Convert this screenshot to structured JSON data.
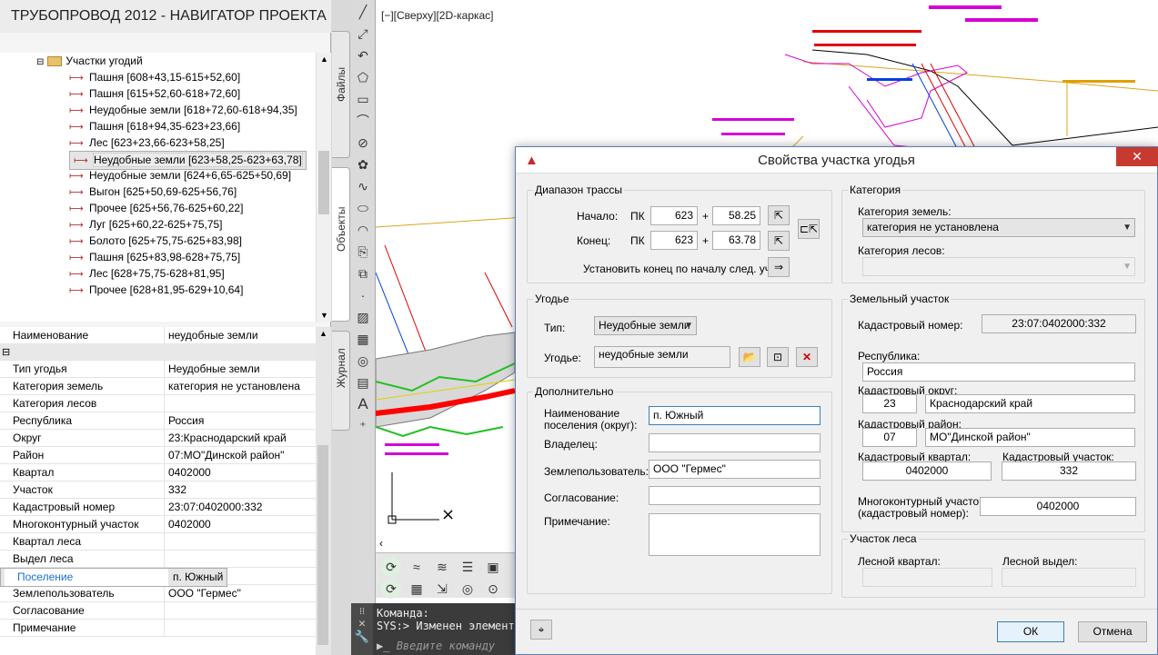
{
  "navigator": {
    "title": "ТРУБОПРОВОД 2012 - НАВИГАТОР ПРОЕКТА",
    "tree_root": "Участки угодий",
    "tree_items": [
      "Пашня [608+43,15-615+52,60]",
      "Пашня [615+52,60-618+72,60]",
      "Неудобные земли [618+72,60-618+94,35]",
      "Пашня [618+94,35-623+23,66]",
      "Лес [623+23,66-623+58,25]",
      "Неудобные земли [623+58,25-623+63,78]",
      "Лес [623+63,78-624+6,65]",
      "Неудобные земли [624+6,65-625+50,69]",
      "Выгон [625+50,69-625+56,76]",
      "Прочее [625+56,76-625+60,22]",
      "Луг [625+60,22-625+75,75]",
      "Болото [625+75,75-625+83,98]",
      "Пашня [625+83,98-628+75,75]",
      "Лес [628+75,75-628+81,95]",
      "Прочее [628+81,95-629+10,64]"
    ],
    "selected_index": 5,
    "properties": [
      {
        "k": "Наименование",
        "v": "неудобные земли"
      },
      {
        "k": "",
        "v": "",
        "section": true
      },
      {
        "k": "Тип угодья",
        "v": "Неудобные земли"
      },
      {
        "k": "Категория земель",
        "v": "категория не установлена"
      },
      {
        "k": "Категория лесов",
        "v": ""
      },
      {
        "k": "Республика",
        "v": "Россия"
      },
      {
        "k": "Округ",
        "v": "23:Краснодарский край"
      },
      {
        "k": "Район",
        "v": "07:МО\"Динской район\""
      },
      {
        "k": "Квартал",
        "v": "0402000"
      },
      {
        "k": "Участок",
        "v": "332"
      },
      {
        "k": "Кадастровый номер",
        "v": "23:07:0402000:332"
      },
      {
        "k": "Многоконтурный участок",
        "v": "0402000"
      },
      {
        "k": "Квартал леса",
        "v": ""
      },
      {
        "k": "Выдел леса",
        "v": ""
      },
      {
        "k": "Поселение",
        "v": "п. Южный",
        "selected": true
      },
      {
        "k": "Владелец",
        "v": ""
      },
      {
        "k": "Землепользователь",
        "v": "ООО \"Гермес\""
      },
      {
        "k": "Согласование",
        "v": ""
      },
      {
        "k": "Примечание",
        "v": ""
      }
    ]
  },
  "side_tabs": {
    "files": "Файлы",
    "objects": "Объекты",
    "journal": "Журнал"
  },
  "viewport": {
    "label": "[−][Сверху][2D-каркас]"
  },
  "command": {
    "line1": "Команда:",
    "line2": "SYS:> Изменен элемент:",
    "placeholder": "Введите команду"
  },
  "dialog": {
    "title": "Свойства участка угодья",
    "range": {
      "legend": "Диапазон трассы",
      "start_label": "Начало:",
      "end_label": "Конец:",
      "pk": "ПК",
      "plus": "+",
      "start_pk": "623",
      "start_plus": "58.25",
      "end_pk": "623",
      "end_plus": "63.78",
      "next_label": "Установить конец по началу след. уч."
    },
    "category": {
      "legend": "Категория",
      "land_label": "Категория земель:",
      "land_value": "категория не установлена",
      "forest_label": "Категория лесов:",
      "forest_value": ""
    },
    "land": {
      "legend": "Угодье",
      "type_label": "Тип:",
      "type_value": "Неудобные земли",
      "name_label": "Угодье:",
      "name_value": "неудобные земли"
    },
    "plot": {
      "legend": "Земельный участок",
      "cad_label": "Кадастровый номер:",
      "cad_value": "23:07:0402000:332",
      "republic_label": "Республика:",
      "republic_value": "Россия",
      "district_label": "Кадастровый округ:",
      "district_code": "23",
      "district_name": "Краснодарский край",
      "region_label": "Кадастровый район:",
      "region_code": "07",
      "region_name": "МО\"Динской район\"",
      "quarter_label": "Кадастровый квартал:",
      "quarter_value": "0402000",
      "lot_label": "Кадастровый участок:",
      "lot_value": "332",
      "multi_label_1": "Многоконтурный участок",
      "multi_label_2": "(кадастровый номер):",
      "multi_value": "0402000"
    },
    "extra": {
      "legend": "Дополнительно",
      "settlement_label_1": "Наименование",
      "settlement_label_2": "поселения (округ):",
      "settlement_value": "п. Южный",
      "owner_label": "Владелец:",
      "owner_value": "",
      "user_label": "Землепользователь:",
      "user_value": "ООО \"Гермес\"",
      "approval_label": "Согласование:",
      "approval_value": "",
      "note_label": "Примечание:",
      "note_value": ""
    },
    "forest": {
      "legend": "Участок леса",
      "quarter_label": "Лесной квартал:",
      "quarter_value": "",
      "section_label": "Лесной выдел:",
      "section_value": ""
    },
    "ok": "ОК",
    "cancel": "Отмена"
  },
  "colors": {
    "accent": "#c63a30",
    "focus": "#3c7fb1",
    "selected_text": "#1a6fd1"
  }
}
